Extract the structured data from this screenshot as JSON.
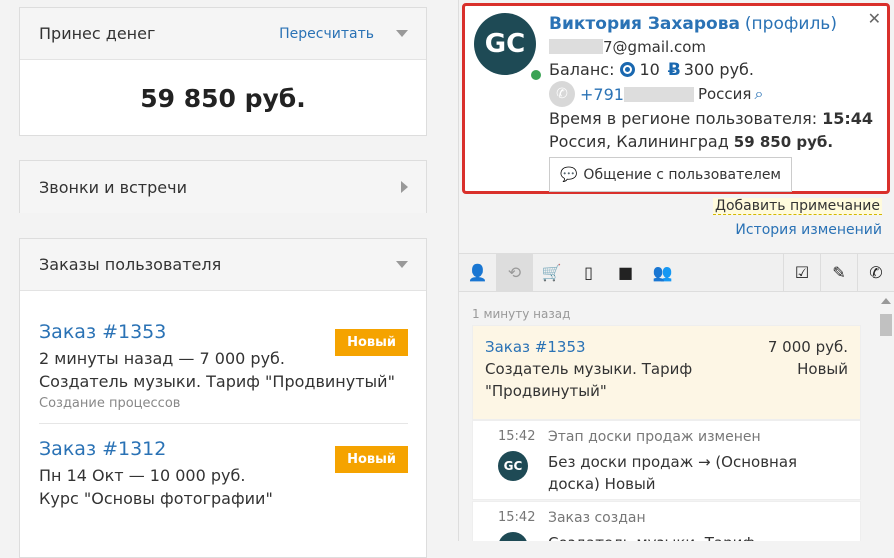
{
  "left": {
    "money_card": {
      "title": "Принес денег",
      "recalc": "Пересчитать",
      "amount": "59 850 руб."
    },
    "calls_card": {
      "title": "Звонки и встречи"
    },
    "orders_card": {
      "title": "Заказы пользователя",
      "orders": [
        {
          "name": "Заказ #1353",
          "badge": "Новый",
          "line": "2 минуты назад — 7 000 руб.",
          "product": "Создатель музыки. Тариф \"Продвинутый\"",
          "sub": "Создание процессов"
        },
        {
          "name": "Заказ #1312",
          "badge": "Новый",
          "line": "Пн 14 Окт — 10 000 руб.",
          "product": "Курс \"Основы фотографии\"",
          "sub": ""
        }
      ]
    }
  },
  "profile": {
    "avatar": "GC",
    "name": "Виктория Захарова",
    "profile_link": "(профиль)",
    "email_suffix": "7@gmail.com",
    "balance_label": "Баланс:",
    "balance_points": "10",
    "balance_rub": "300 руб.",
    "phone_prefix": "+791",
    "country": "Россия",
    "time_label": "Время в регионе пользователя:",
    "time_value": "15:44",
    "location": "Россия, Калининград",
    "location_amount": "59 850 руб.",
    "chat_button": "Общение с пользователем",
    "close": "✕"
  },
  "links": {
    "add_note": "Добавить примечание",
    "history": "История изменений"
  },
  "feed": {
    "time_header": "1 минуту назад",
    "order": {
      "name": "Заказ #1353",
      "amount": "7 000 руб.",
      "product": "Создатель музыки. Тариф \"Продвинутый\"",
      "status": "Новый"
    },
    "events": [
      {
        "time": "15:42",
        "title": "Этап доски продаж изменен",
        "body": "Без доски продаж → (Основная доска) Новый",
        "avatar": "GC"
      },
      {
        "time": "15:42",
        "title": "Заказ создан",
        "body": "Создатель музыки. Тариф",
        "avatar": "GC"
      }
    ]
  },
  "colors": {
    "accent": "#2a72b5",
    "badge": "#f5a300",
    "highlight_border": "#d9302b",
    "online": "#3aa354"
  }
}
